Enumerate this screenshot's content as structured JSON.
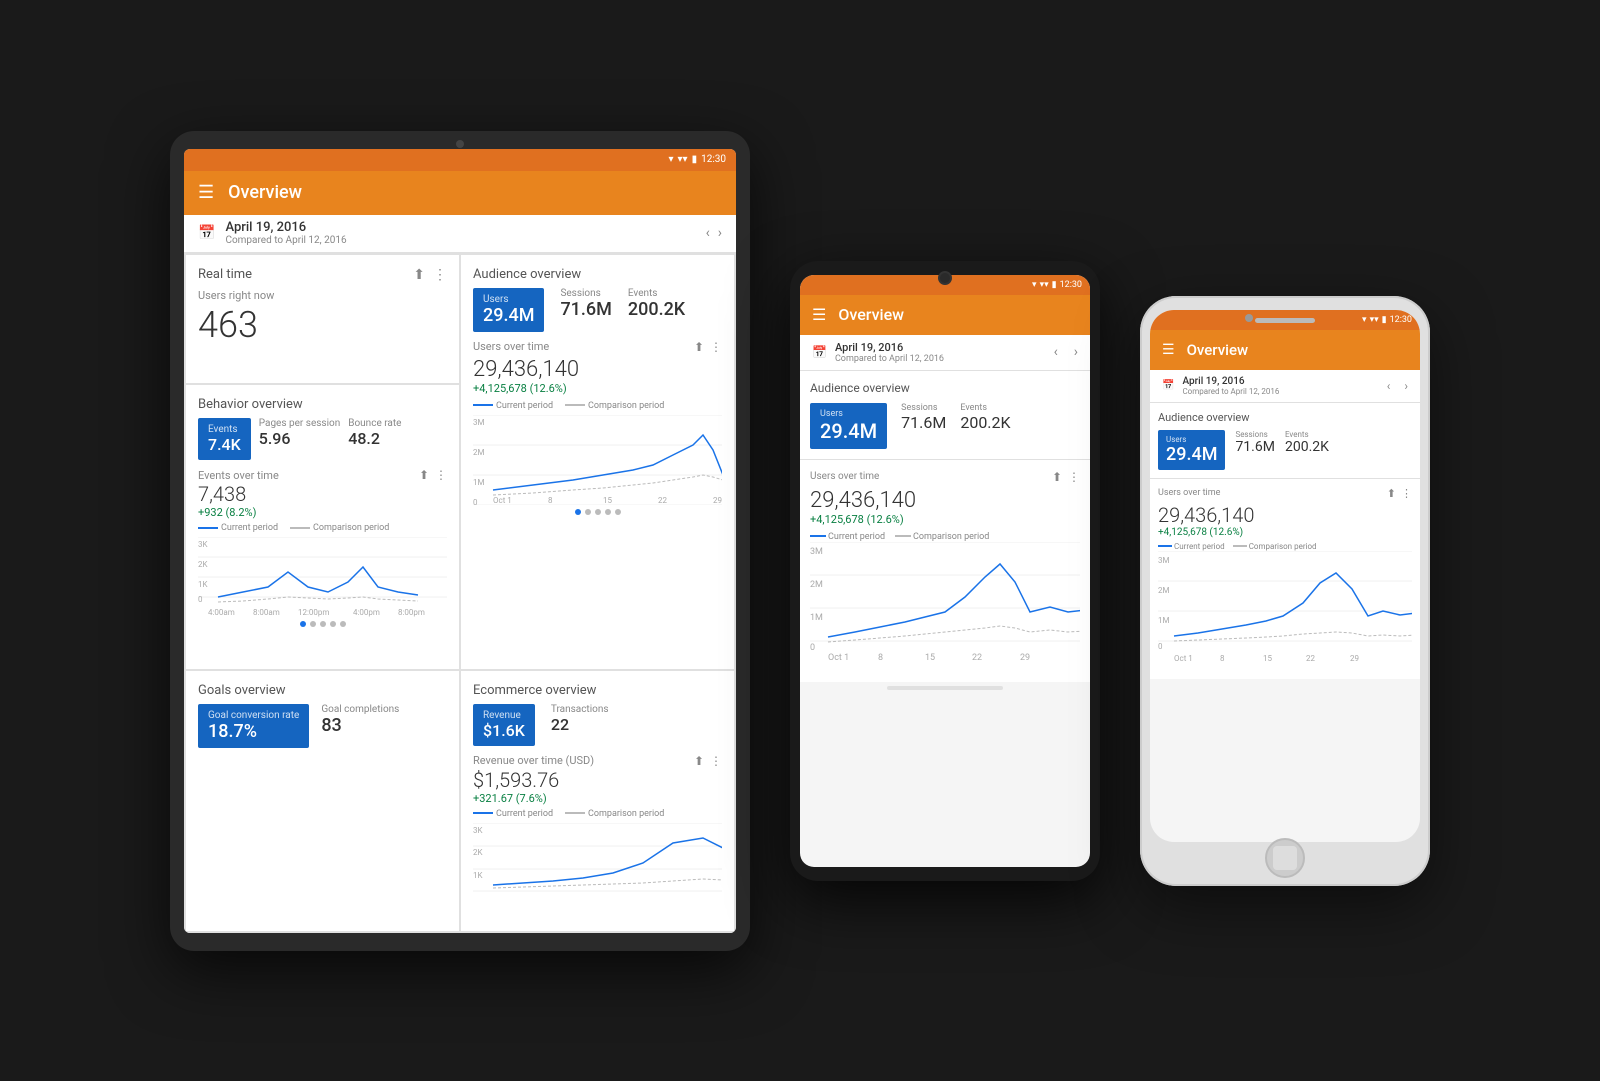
{
  "app": {
    "title": "Overview",
    "status_bar": "12:30"
  },
  "date": {
    "primary": "April 19, 2016",
    "compare": "Compared to April 12, 2016"
  },
  "realtime": {
    "title": "Real time",
    "label": "Users right now",
    "value": "463"
  },
  "audience": {
    "title": "Audience overview",
    "users_tab": "Users",
    "users_val": "29.4M",
    "sessions_label": "Sessions",
    "sessions_val": "71.6M",
    "events_label": "Events",
    "events_val": "200.2K",
    "users_over_time_label": "Users over time",
    "users_count": "29,436,140",
    "change": "+4,125,678 (12.6%)",
    "legend_current": "Current period",
    "legend_compare": "Comparison period",
    "x_labels": [
      "Oct 1",
      "8",
      "15",
      "22",
      "29"
    ],
    "y_labels": [
      "3M",
      "2M",
      "1M",
      "0"
    ]
  },
  "behavior": {
    "title": "Behavior overview",
    "events_label": "Events",
    "events_val": "7.4K",
    "pages_label": "Pages per session",
    "pages_val": "5.96",
    "bounce_label": "Bounce rate",
    "bounce_val": "48.2",
    "events_over_time": "Events over time",
    "events_count": "7,438",
    "events_change": "+932 (8.2%)",
    "x_labels": [
      "4:00am",
      "8:00am",
      "12:00pm",
      "4:00pm",
      "8:00pm"
    ],
    "y_labels": [
      "3K",
      "2K",
      "1K",
      "0"
    ]
  },
  "ecommerce": {
    "title": "Ecommerce overview",
    "revenue_label": "Revenue",
    "revenue_val": "$1.6K",
    "transactions_label": "Transactions",
    "transactions_val": "22",
    "revenue_over_time": "Revenue over time (USD)",
    "revenue_count": "$1,593.76",
    "revenue_change": "+321.67 (7.6%)",
    "legend_current": "Current period",
    "legend_compare": "Comparison period"
  },
  "goals": {
    "title": "Goals overview",
    "conversion_label": "Goal conversion rate",
    "conversion_val": "18.7%",
    "completions_label": "Goal completions",
    "completions_val": "83"
  }
}
